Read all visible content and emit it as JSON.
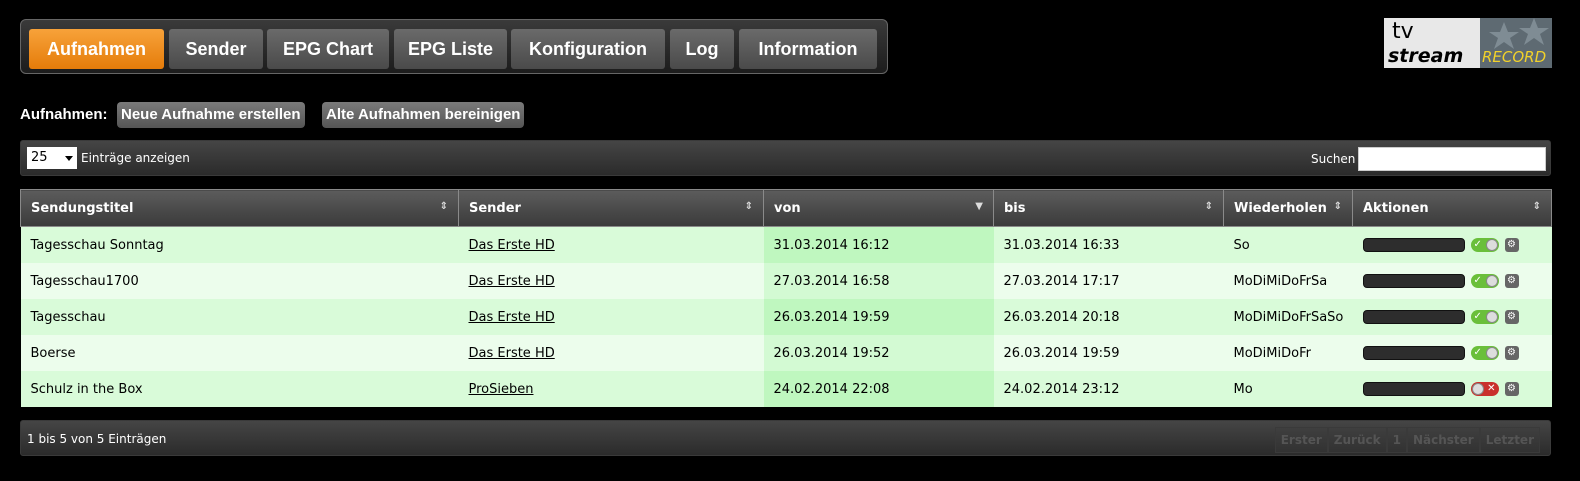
{
  "nav": {
    "tabs": [
      {
        "label": "Aufnahmen"
      },
      {
        "label": "Sender"
      },
      {
        "label": "EPG Chart"
      },
      {
        "label": "EPG Liste"
      },
      {
        "label": "Konfiguration"
      },
      {
        "label": "Log"
      },
      {
        "label": "Information"
      }
    ],
    "active_color": "#f28c1a"
  },
  "logo": {
    "line1": "tv",
    "line2": "stream",
    "line3": "RECORD"
  },
  "actions": {
    "label": "Aufnahmen:",
    "new_label": "Neue Aufnahme erstellen",
    "clean_label": "Alte Aufnahmen bereinigen"
  },
  "toolbar": {
    "length_value": "25",
    "length_label": "Einträge anzeigen",
    "search_label": "Suchen",
    "search_value": ""
  },
  "table": {
    "columns": [
      "Sendungstitel",
      "Sender",
      "von",
      "bis",
      "Wiederholen",
      "Aktionen"
    ],
    "rows": [
      {
        "title": "Tagesschau Sonntag",
        "channel": "Das Erste HD",
        "from": "31.03.2014 16:12",
        "to": "31.03.2014 16:33",
        "repeat": "So",
        "enabled": "on"
      },
      {
        "title": "Tagesschau1700",
        "channel": "Das Erste HD",
        "from": "27.03.2014 16:58",
        "to": "27.03.2014 17:17",
        "repeat": "MoDiMiDoFrSa",
        "enabled": "on"
      },
      {
        "title": "Tagesschau",
        "channel": "Das Erste HD",
        "from": "26.03.2014 19:59",
        "to": "26.03.2014 20:18",
        "repeat": "MoDiMiDoFrSaSo",
        "enabled": "on"
      },
      {
        "title": "Boerse",
        "channel": "Das Erste HD",
        "from": "26.03.2014 19:52",
        "to": "26.03.2014 19:59",
        "repeat": "MoDiMiDoFr",
        "enabled": "on"
      },
      {
        "title": "Schulz in the Box",
        "channel": "ProSieben",
        "from": "24.02.2014 22:08",
        "to": "24.02.2014 23:12",
        "repeat": "Mo",
        "enabled": "off"
      }
    ]
  },
  "footer": {
    "info": "1 bis 5 von 5 Einträgen",
    "pager": [
      "Erster",
      "Zurück",
      "1",
      "Nächster",
      "Letzter"
    ]
  }
}
